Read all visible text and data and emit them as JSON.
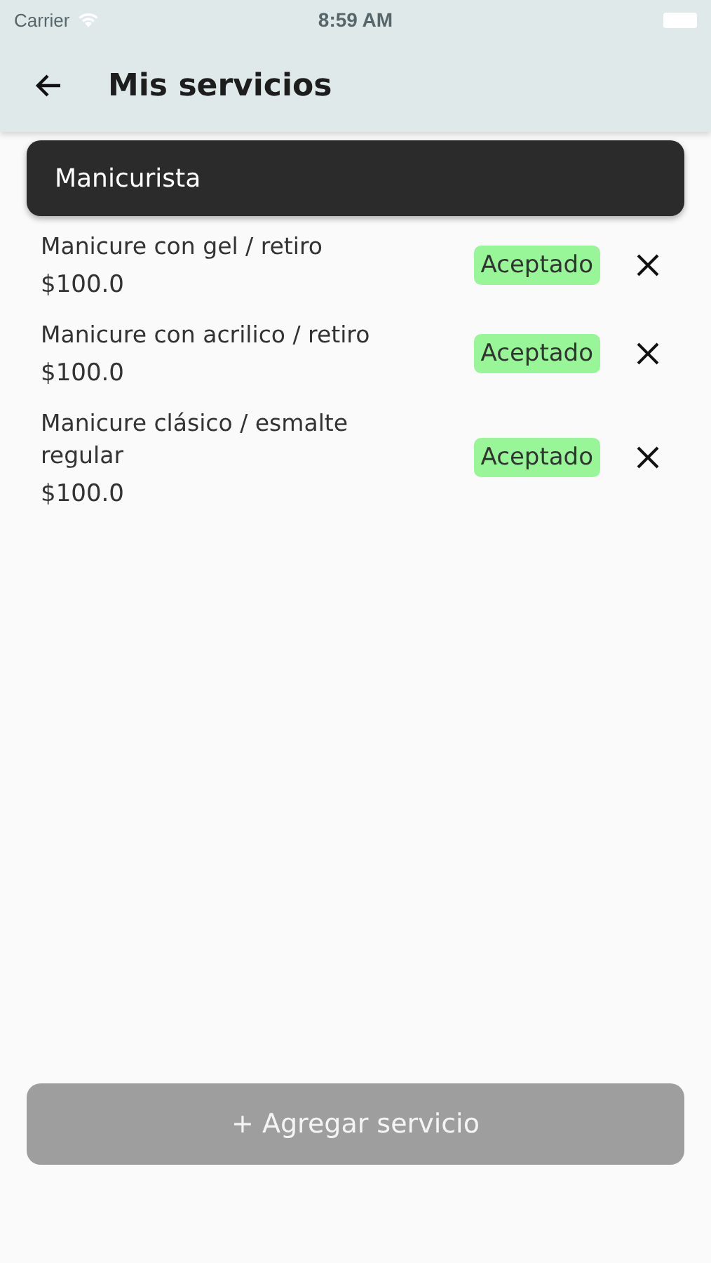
{
  "status_bar": {
    "carrier": "Carrier",
    "time": "8:59 AM"
  },
  "app_bar": {
    "title": "Mis servicios"
  },
  "category": {
    "title": "Manicurista"
  },
  "services": [
    {
      "name": "Manicure con gel / retiro",
      "price": "$100.0",
      "status": "Aceptado"
    },
    {
      "name": "Manicure con acrilico / retiro",
      "price": "$100.0",
      "status": "Aceptado"
    },
    {
      "name": "Manicure clásico / esmalte regular",
      "price": "$100.0",
      "status": "Aceptado"
    }
  ],
  "add_button": {
    "label": "+ Agregar servicio",
    "disabled": true
  }
}
